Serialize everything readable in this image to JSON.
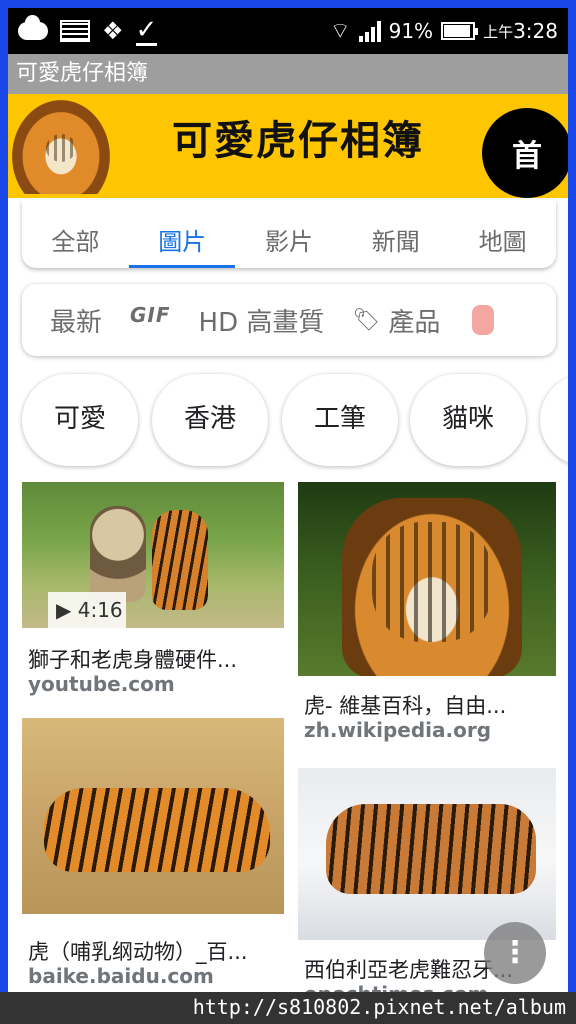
{
  "status_bar": {
    "battery_pct": "91%",
    "time_prefix": "上午",
    "time": "3:28",
    "icons": [
      "cloud-icon",
      "gallery-icon",
      "dropbox-icon",
      "checkmark-icon",
      "wifi-icon",
      "signal-icon",
      "battery-icon"
    ]
  },
  "app": {
    "title": "可愛虎仔相簿"
  },
  "banner": {
    "title": "可愛虎仔相簿",
    "home_label": "首"
  },
  "tabs": [
    {
      "label": "全部",
      "active": false
    },
    {
      "label": "圖片",
      "active": true
    },
    {
      "label": "影片",
      "active": false
    },
    {
      "label": "新聞",
      "active": false
    },
    {
      "label": "地圖",
      "active": false
    }
  ],
  "filters": [
    {
      "label": "最新"
    },
    {
      "label": "GIF"
    },
    {
      "label": "HD 高畫質"
    },
    {
      "label": "產品",
      "icon": "tag-icon"
    }
  ],
  "chips": [
    "可愛",
    "香港",
    "工筆",
    "貓咪"
  ],
  "results": [
    {
      "title": "獅子和老虎身體硬件...",
      "source": "youtube.com",
      "duration": "▶ 4:16"
    },
    {
      "title": "虎- 維基百科，自由...",
      "source": "zh.wikipedia.org"
    },
    {
      "title": "虎（哺乳纲动物）_百...",
      "source": "baike.baidu.com"
    },
    {
      "title": "西伯利亞老虎難忍牙...",
      "source": "epochtimes.com"
    }
  ],
  "fab_label": "⋮",
  "watermark": "http://s810802.pixnet.net/album"
}
